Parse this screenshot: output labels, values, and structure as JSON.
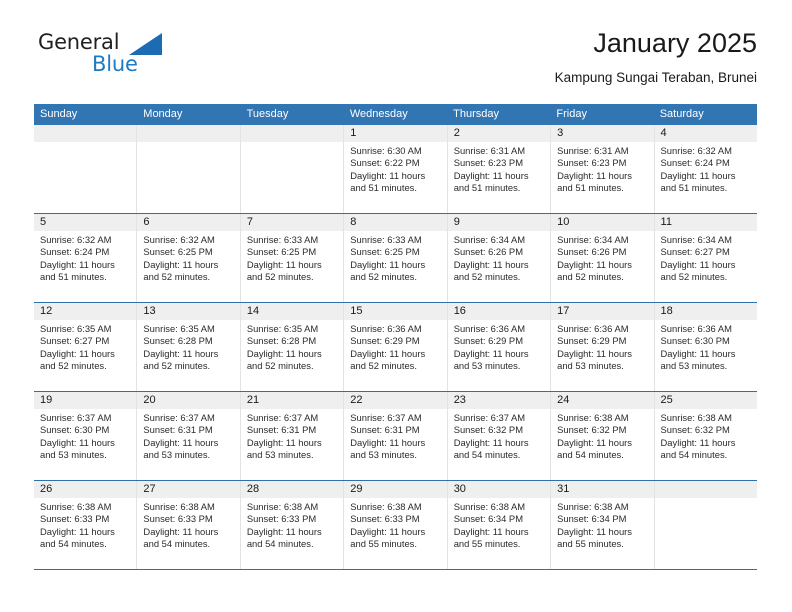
{
  "brand": {
    "name_part1": "General",
    "name_part2": "Blue",
    "triangle_color": "#1d6cb3",
    "blue_text_color": "#1d7bc4"
  },
  "header": {
    "title": "January 2025",
    "location": "Kampung Sungai Teraban, Brunei"
  },
  "theme": {
    "header_blue": "#3275b3",
    "rule_blue": "#2f6fae",
    "daynum_band": "#efefef",
    "column_divider": "#e3e3e3"
  },
  "calendar": {
    "weekday_headers": [
      "Sunday",
      "Monday",
      "Tuesday",
      "Wednesday",
      "Thursday",
      "Friday",
      "Saturday"
    ],
    "labels": {
      "sunrise": "Sunrise:",
      "sunset": "Sunset:",
      "daylight": "Daylight:"
    },
    "weeks": [
      [
        {
          "day": "",
          "empty": true
        },
        {
          "day": "",
          "empty": true
        },
        {
          "day": "",
          "empty": true
        },
        {
          "day": "1",
          "sunrise": "Sunrise: 6:30 AM",
          "sunset": "Sunset: 6:22 PM",
          "daylight": "Daylight: 11 hours and 51 minutes."
        },
        {
          "day": "2",
          "sunrise": "Sunrise: 6:31 AM",
          "sunset": "Sunset: 6:23 PM",
          "daylight": "Daylight: 11 hours and 51 minutes."
        },
        {
          "day": "3",
          "sunrise": "Sunrise: 6:31 AM",
          "sunset": "Sunset: 6:23 PM",
          "daylight": "Daylight: 11 hours and 51 minutes."
        },
        {
          "day": "4",
          "sunrise": "Sunrise: 6:32 AM",
          "sunset": "Sunset: 6:24 PM",
          "daylight": "Daylight: 11 hours and 51 minutes."
        }
      ],
      [
        {
          "day": "5",
          "sunrise": "Sunrise: 6:32 AM",
          "sunset": "Sunset: 6:24 PM",
          "daylight": "Daylight: 11 hours and 51 minutes."
        },
        {
          "day": "6",
          "sunrise": "Sunrise: 6:32 AM",
          "sunset": "Sunset: 6:25 PM",
          "daylight": "Daylight: 11 hours and 52 minutes."
        },
        {
          "day": "7",
          "sunrise": "Sunrise: 6:33 AM",
          "sunset": "Sunset: 6:25 PM",
          "daylight": "Daylight: 11 hours and 52 minutes."
        },
        {
          "day": "8",
          "sunrise": "Sunrise: 6:33 AM",
          "sunset": "Sunset: 6:25 PM",
          "daylight": "Daylight: 11 hours and 52 minutes."
        },
        {
          "day": "9",
          "sunrise": "Sunrise: 6:34 AM",
          "sunset": "Sunset: 6:26 PM",
          "daylight": "Daylight: 11 hours and 52 minutes."
        },
        {
          "day": "10",
          "sunrise": "Sunrise: 6:34 AM",
          "sunset": "Sunset: 6:26 PM",
          "daylight": "Daylight: 11 hours and 52 minutes."
        },
        {
          "day": "11",
          "sunrise": "Sunrise: 6:34 AM",
          "sunset": "Sunset: 6:27 PM",
          "daylight": "Daylight: 11 hours and 52 minutes."
        }
      ],
      [
        {
          "day": "12",
          "sunrise": "Sunrise: 6:35 AM",
          "sunset": "Sunset: 6:27 PM",
          "daylight": "Daylight: 11 hours and 52 minutes."
        },
        {
          "day": "13",
          "sunrise": "Sunrise: 6:35 AM",
          "sunset": "Sunset: 6:28 PM",
          "daylight": "Daylight: 11 hours and 52 minutes."
        },
        {
          "day": "14",
          "sunrise": "Sunrise: 6:35 AM",
          "sunset": "Sunset: 6:28 PM",
          "daylight": "Daylight: 11 hours and 52 minutes."
        },
        {
          "day": "15",
          "sunrise": "Sunrise: 6:36 AM",
          "sunset": "Sunset: 6:29 PM",
          "daylight": "Daylight: 11 hours and 52 minutes."
        },
        {
          "day": "16",
          "sunrise": "Sunrise: 6:36 AM",
          "sunset": "Sunset: 6:29 PM",
          "daylight": "Daylight: 11 hours and 53 minutes."
        },
        {
          "day": "17",
          "sunrise": "Sunrise: 6:36 AM",
          "sunset": "Sunset: 6:29 PM",
          "daylight": "Daylight: 11 hours and 53 minutes."
        },
        {
          "day": "18",
          "sunrise": "Sunrise: 6:36 AM",
          "sunset": "Sunset: 6:30 PM",
          "daylight": "Daylight: 11 hours and 53 minutes."
        }
      ],
      [
        {
          "day": "19",
          "sunrise": "Sunrise: 6:37 AM",
          "sunset": "Sunset: 6:30 PM",
          "daylight": "Daylight: 11 hours and 53 minutes."
        },
        {
          "day": "20",
          "sunrise": "Sunrise: 6:37 AM",
          "sunset": "Sunset: 6:31 PM",
          "daylight": "Daylight: 11 hours and 53 minutes."
        },
        {
          "day": "21",
          "sunrise": "Sunrise: 6:37 AM",
          "sunset": "Sunset: 6:31 PM",
          "daylight": "Daylight: 11 hours and 53 minutes."
        },
        {
          "day": "22",
          "sunrise": "Sunrise: 6:37 AM",
          "sunset": "Sunset: 6:31 PM",
          "daylight": "Daylight: 11 hours and 53 minutes."
        },
        {
          "day": "23",
          "sunrise": "Sunrise: 6:37 AM",
          "sunset": "Sunset: 6:32 PM",
          "daylight": "Daylight: 11 hours and 54 minutes."
        },
        {
          "day": "24",
          "sunrise": "Sunrise: 6:38 AM",
          "sunset": "Sunset: 6:32 PM",
          "daylight": "Daylight: 11 hours and 54 minutes."
        },
        {
          "day": "25",
          "sunrise": "Sunrise: 6:38 AM",
          "sunset": "Sunset: 6:32 PM",
          "daylight": "Daylight: 11 hours and 54 minutes."
        }
      ],
      [
        {
          "day": "26",
          "sunrise": "Sunrise: 6:38 AM",
          "sunset": "Sunset: 6:33 PM",
          "daylight": "Daylight: 11 hours and 54 minutes."
        },
        {
          "day": "27",
          "sunrise": "Sunrise: 6:38 AM",
          "sunset": "Sunset: 6:33 PM",
          "daylight": "Daylight: 11 hours and 54 minutes."
        },
        {
          "day": "28",
          "sunrise": "Sunrise: 6:38 AM",
          "sunset": "Sunset: 6:33 PM",
          "daylight": "Daylight: 11 hours and 54 minutes."
        },
        {
          "day": "29",
          "sunrise": "Sunrise: 6:38 AM",
          "sunset": "Sunset: 6:33 PM",
          "daylight": "Daylight: 11 hours and 55 minutes."
        },
        {
          "day": "30",
          "sunrise": "Sunrise: 6:38 AM",
          "sunset": "Sunset: 6:34 PM",
          "daylight": "Daylight: 11 hours and 55 minutes."
        },
        {
          "day": "31",
          "sunrise": "Sunrise: 6:38 AM",
          "sunset": "Sunset: 6:34 PM",
          "daylight": "Daylight: 11 hours and 55 minutes."
        },
        {
          "day": "",
          "empty": true
        }
      ]
    ]
  }
}
